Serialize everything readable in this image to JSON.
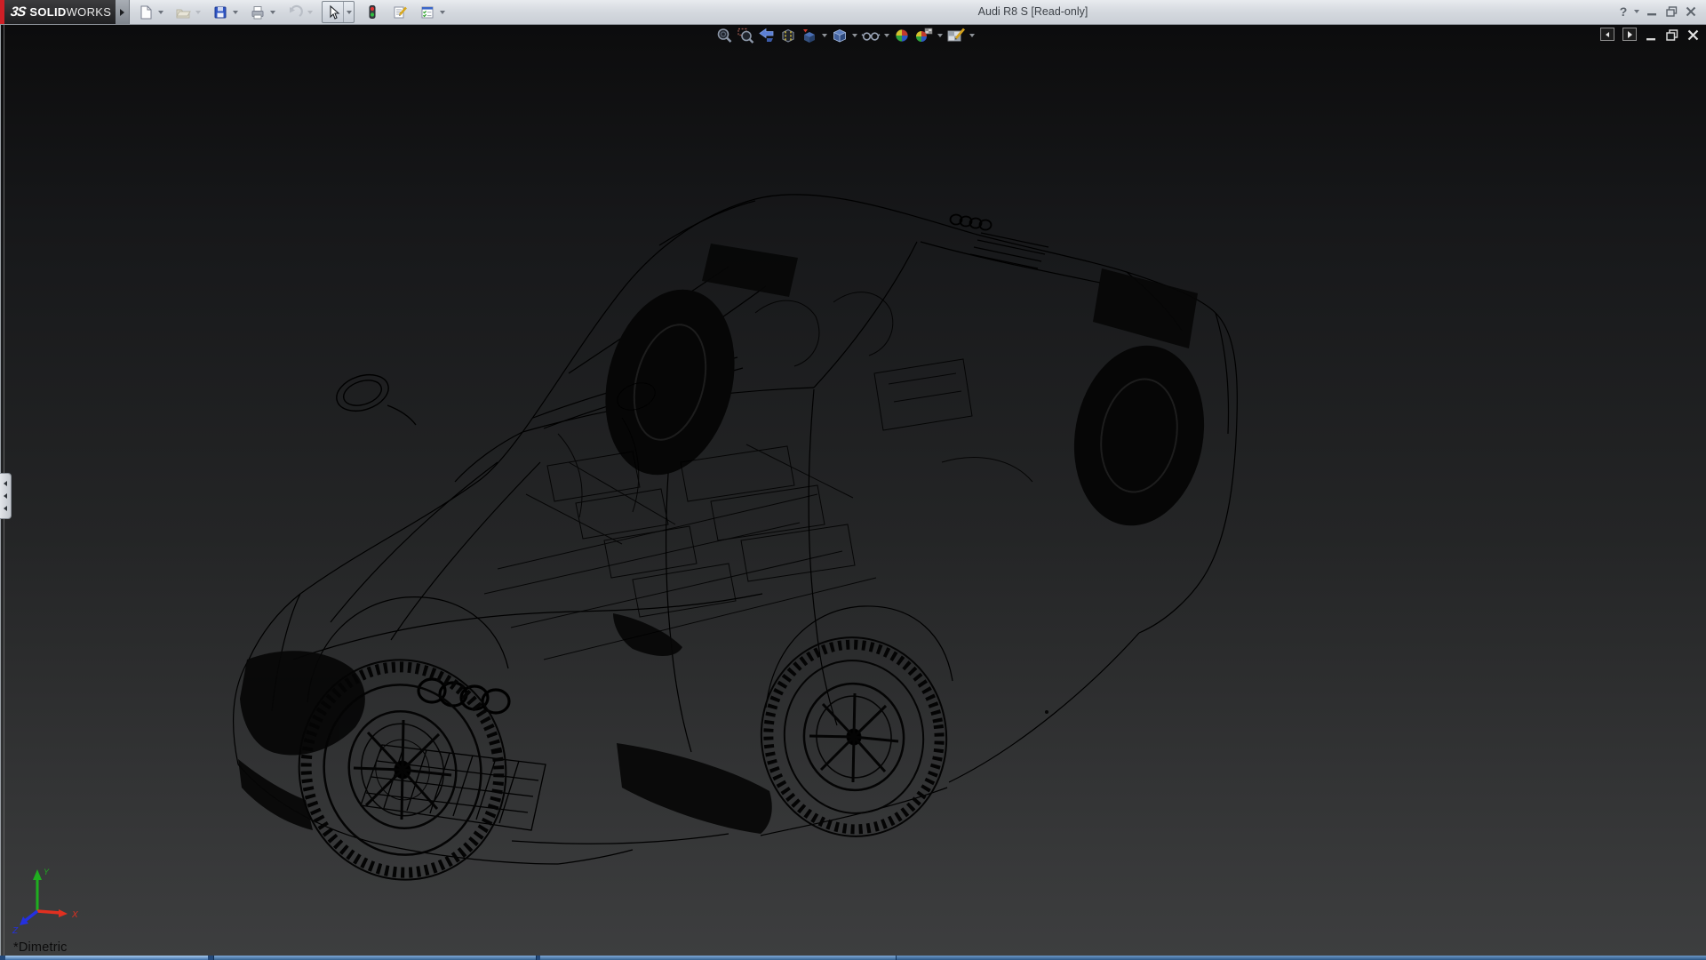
{
  "window": {
    "title": "Audi R8 S [Read-only]",
    "help_glyph": "?",
    "controls": {
      "help": "Help",
      "minimize": "Minimize",
      "restore": "Restore Down",
      "close": "Close"
    }
  },
  "brand": {
    "logo_mark": "3S",
    "name_bold": "SOLID",
    "name_light": "WORKS",
    "accent_color": "#cf1f26",
    "menu_expander": "Expand menu"
  },
  "standard_toolbar": {
    "items": [
      {
        "id": "new",
        "label": "New",
        "dropdown": true,
        "enabled": true
      },
      {
        "id": "open",
        "label": "Open",
        "dropdown": true,
        "enabled": false
      },
      {
        "id": "save",
        "label": "Save",
        "dropdown": true,
        "enabled": true
      },
      {
        "id": "print",
        "label": "Print",
        "dropdown": true,
        "enabled": true
      },
      {
        "id": "undo",
        "label": "Undo",
        "dropdown": true,
        "enabled": false
      },
      {
        "id": "select",
        "label": "Select",
        "dropdown": true,
        "enabled": true,
        "active": true
      },
      {
        "id": "rebuild",
        "label": "Rebuild",
        "dropdown": false,
        "enabled": true
      },
      {
        "id": "file-properties",
        "label": "File Properties",
        "dropdown": false,
        "enabled": true
      },
      {
        "id": "options",
        "label": "Options",
        "dropdown": true,
        "enabled": true
      }
    ]
  },
  "heads_up_toolbar": {
    "items": [
      {
        "id": "zoom-to-fit",
        "label": "Zoom to Fit"
      },
      {
        "id": "zoom-to-area",
        "label": "Zoom to Area"
      },
      {
        "id": "previous-view",
        "label": "Previous View"
      },
      {
        "id": "section-view",
        "label": "Section View"
      },
      {
        "id": "view-orientation",
        "label": "View Orientation",
        "dropdown": true
      },
      {
        "id": "display-style",
        "label": "Display Style",
        "dropdown": true
      },
      {
        "id": "hide-show-items",
        "label": "Hide/Show Items",
        "dropdown": true
      },
      {
        "id": "edit-appearance",
        "label": "Edit Appearance"
      },
      {
        "id": "apply-scene",
        "label": "Apply Scene",
        "dropdown": true
      },
      {
        "id": "view-settings",
        "label": "View Settings",
        "dropdown": true
      }
    ]
  },
  "document_window": {
    "controls": [
      {
        "id": "pane-left",
        "label": "Pane Left"
      },
      {
        "id": "pane-right",
        "label": "Pane Right"
      },
      {
        "id": "minimize",
        "label": "Minimize Document"
      },
      {
        "id": "restore",
        "label": "Restore Document"
      },
      {
        "id": "close",
        "label": "Close Document"
      }
    ]
  },
  "viewport": {
    "model_name": "Audi R8 S",
    "display_style": "Wireframe",
    "view_label": "*Dimetric",
    "background_top": "#0c0c0d",
    "background_bottom": "#3d3e3f",
    "wireframe_color": "#000000"
  },
  "triad": {
    "x": {
      "label": "X",
      "color": "#e03020"
    },
    "y": {
      "label": "Y",
      "color": "#1fae1f"
    },
    "z": {
      "label": "Z",
      "color": "#2430e0"
    }
  },
  "splitter": {
    "label": "FeatureManager splitter"
  },
  "taskbar": {
    "color": "#2d5784",
    "highlight": "#8fb8e4"
  }
}
